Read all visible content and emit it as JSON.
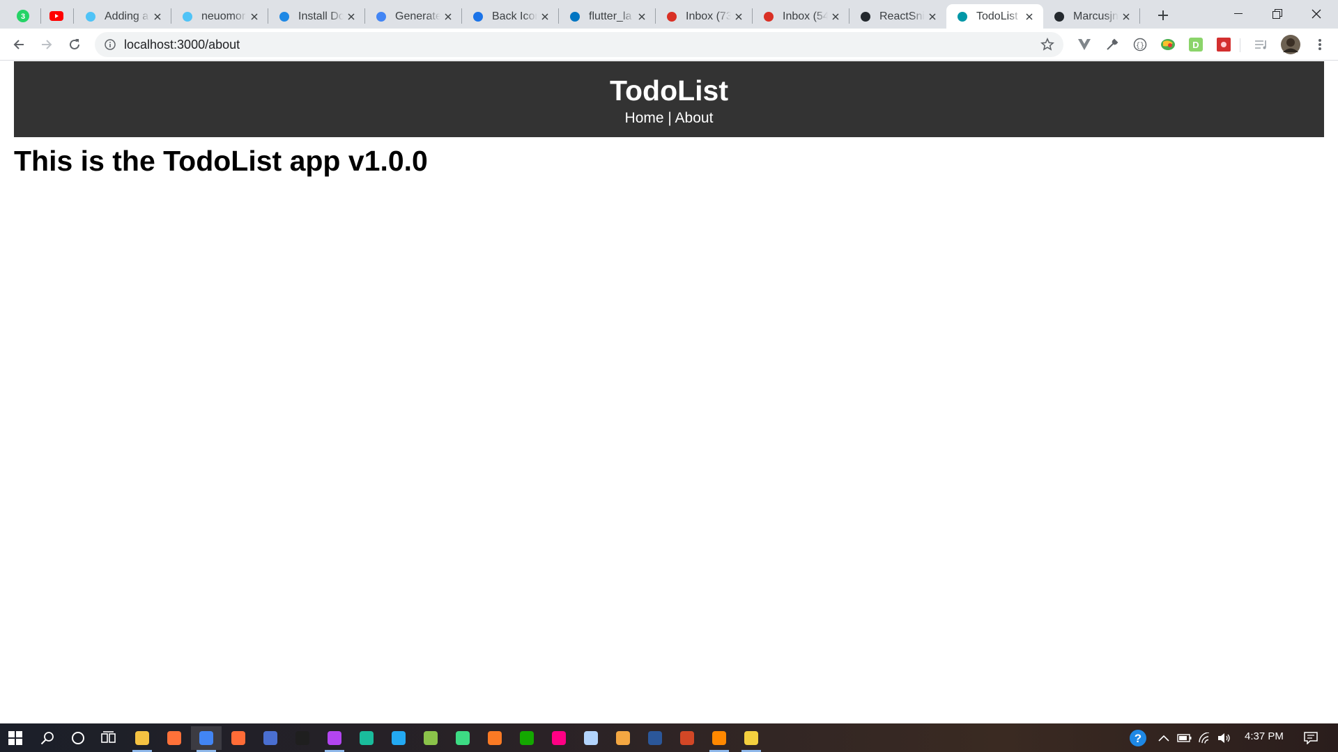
{
  "browser": {
    "pinned_tabs": [
      {
        "name": "whatsapp-tab",
        "badge": "3",
        "color": "#25d366"
      },
      {
        "name": "youtube-tab",
        "color": "#ff0000"
      }
    ],
    "tabs": [
      {
        "title": "Adding a",
        "icon": "flutter-icon",
        "color": "#4fc3f7"
      },
      {
        "title": "neuomor",
        "icon": "flutter-icon",
        "color": "#4fc3f7"
      },
      {
        "title": "Install Do",
        "icon": "edge-icon",
        "color": "#1e88e5"
      },
      {
        "title": "Generate",
        "icon": "google-icon",
        "color": "#4285f4"
      },
      {
        "title": "Back Icon",
        "icon": "bookmark-icon",
        "color": "#1a73e8"
      },
      {
        "title": "flutter_la",
        "icon": "dart-icon",
        "color": "#0175c2"
      },
      {
        "title": "Inbox (73",
        "icon": "gmail-icon",
        "color": "#d93025"
      },
      {
        "title": "Inbox (54",
        "icon": "gmail-icon",
        "color": "#d93025"
      },
      {
        "title": "ReactSni",
        "icon": "github-icon",
        "color": "#24292e"
      },
      {
        "title": "TodoList",
        "icon": "react-icon",
        "color": "#0097a7",
        "active": true
      },
      {
        "title": "Marcusjn",
        "icon": "github-icon",
        "color": "#24292e"
      }
    ],
    "url": "localhost:3000/about"
  },
  "app": {
    "title": "TodoList",
    "nav": {
      "home": "Home",
      "separator": " | ",
      "about": "About"
    },
    "heading": "This is the TodoList app v1.0.0"
  },
  "taskbar": {
    "clock": "4:37 PM",
    "apps": [
      {
        "name": "file-explorer-icon",
        "color": "#f5c242",
        "running": true
      },
      {
        "name": "firefox-icon",
        "color": "#ff7139"
      },
      {
        "name": "chrome-icon",
        "color": "#4285f4",
        "running": true,
        "active": true
      },
      {
        "name": "postman-icon",
        "color": "#ff6c37"
      },
      {
        "name": "terminal-icon",
        "color": "#4a6fd1"
      },
      {
        "name": "intellij-icon",
        "color": "#1f1f1f"
      },
      {
        "name": "phpstorm-icon",
        "color": "#b345f1",
        "running": true
      },
      {
        "name": "gitkraken-icon",
        "color": "#1abc9c"
      },
      {
        "name": "vscode-icon",
        "color": "#23a9f2"
      },
      {
        "name": "notepad-icon",
        "color": "#8bc34a"
      },
      {
        "name": "android-studio-icon",
        "color": "#3ddc84"
      },
      {
        "name": "xampp-icon",
        "color": "#fb7a24"
      },
      {
        "name": "upwork-icon",
        "color": "#14a800"
      },
      {
        "name": "flickr-icon",
        "color": "#ff0084"
      },
      {
        "name": "virtualbox-icon",
        "color": "#b3d4fc"
      },
      {
        "name": "package-icon",
        "color": "#f4a742"
      },
      {
        "name": "word-icon",
        "color": "#2b579a"
      },
      {
        "name": "powerpoint-icon",
        "color": "#d24726"
      },
      {
        "name": "vlc-icon",
        "color": "#ff8800",
        "running": true
      },
      {
        "name": "git-icon",
        "color": "#f4d03f",
        "running": true
      }
    ]
  }
}
